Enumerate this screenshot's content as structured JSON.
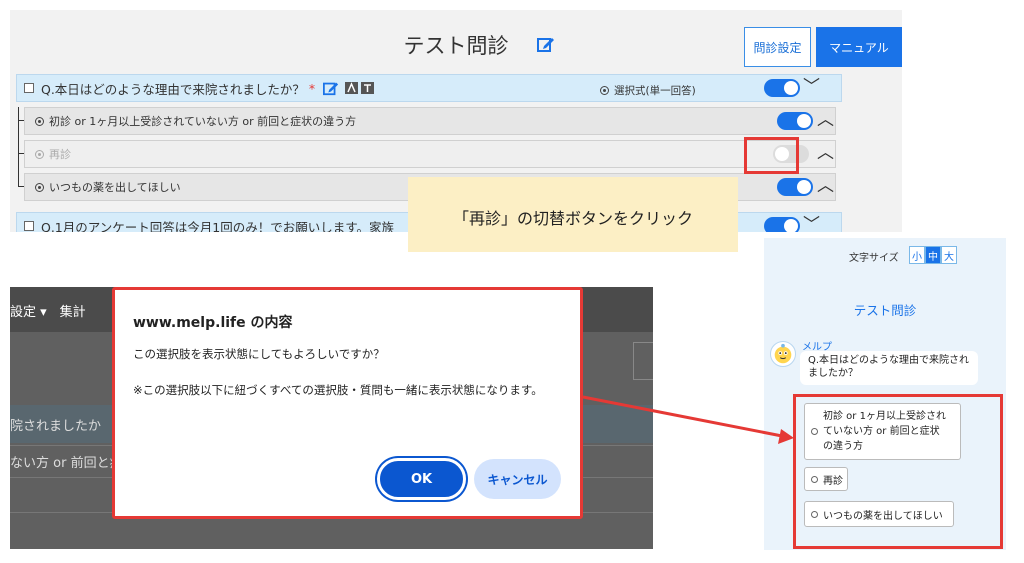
{
  "editor": {
    "title": "テスト問診",
    "settings_button": "問診設定",
    "manual_button": "マニュアル",
    "questions": [
      {
        "label": "Q.本日はどのような理由で来院されましたか？",
        "required_mark": "*",
        "type": "選択式(単一回答)",
        "visible": true
      },
      {
        "label": "Q.1月のアンケート回答は今月1回のみ！でお願いします。家族",
        "visible": true
      }
    ],
    "answers": [
      {
        "label": "初診 or 1ヶ月以上受診されていない方 or 前回と症状の違う方",
        "visible": true
      },
      {
        "label": "再診",
        "visible": false
      },
      {
        "label": "いつもの薬を出してほしい",
        "visible": true
      }
    ]
  },
  "callout": "「再診」の切替ボタンをクリック",
  "background_window": {
    "menu_text": "設定 ▾　集計",
    "partial_question": "院されましたか",
    "partial_answer": "ない方 or 前回と症"
  },
  "dialog": {
    "title": "www.melp.life の内容",
    "message1": "この選択肢を表示状態にしてもよろしいですか？",
    "message2": "※この選択肢以下に紐づくすべての選択肢・質問も一緒に表示状態になります。",
    "ok": "OK",
    "cancel": "キャンセル"
  },
  "preview": {
    "font_size_label": "文字サイズ",
    "font_sizes": [
      "小",
      "中",
      "大"
    ],
    "title": "テスト問診",
    "bot_name": "メルプ",
    "question": "Q.本日はどのような理由で来院されましたか？",
    "choices": [
      "初診 or 1ヶ月以上受診されていない方 or 前回と症状の違う方",
      "再診",
      "いつもの薬を出してほしい"
    ]
  },
  "colors": {
    "accent": "#1a73e8",
    "highlight": "#e53935",
    "callout_bg": "#fcefc5",
    "question_bg": "#d6ecfa"
  }
}
